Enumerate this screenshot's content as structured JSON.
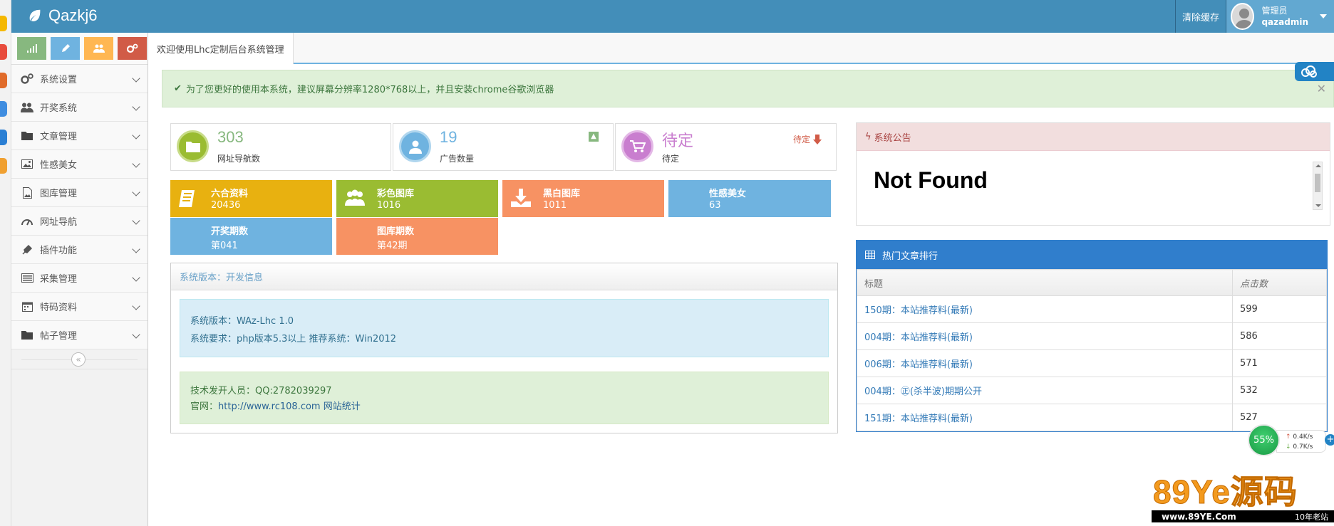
{
  "colors": {
    "navbar": "#438eb9",
    "green": "#87b87f",
    "blue": "#6fb3e0",
    "orange": "#ffb752",
    "red": "#d15b47",
    "tile_yellow": "#e8b110",
    "tile_green": "#9abc32",
    "tile_salmon": "#f79263",
    "tile_sky": "#6fb3e0",
    "hot_blue": "#307ecc"
  },
  "navbar": {
    "brand": "Qazkj6",
    "clear_cache": "清除缓存",
    "user_role": "管理员",
    "user_name": "qazadmin"
  },
  "shortcuts": [
    {
      "icon": "signal-icon"
    },
    {
      "icon": "pencil-icon"
    },
    {
      "icon": "users-icon"
    },
    {
      "icon": "cogs-icon"
    }
  ],
  "sidebar": {
    "items": [
      {
        "label": "系统设置",
        "icon": "cogs-icon"
      },
      {
        "label": "开奖系统",
        "icon": "users-icon"
      },
      {
        "label": "文章管理",
        "icon": "folder-icon"
      },
      {
        "label": "性感美女",
        "icon": "picture-icon"
      },
      {
        "label": "图库管理",
        "icon": "file-image-icon"
      },
      {
        "label": "网址导航",
        "icon": "dashboard-icon"
      },
      {
        "label": "插件功能",
        "icon": "plug-icon"
      },
      {
        "label": "采集管理",
        "icon": "list-alt-icon"
      },
      {
        "label": "特码资料",
        "icon": "calendar-icon"
      },
      {
        "label": "帖子管理",
        "icon": "folder-icon"
      }
    ]
  },
  "tab": {
    "label": "欢迎使用Lhc定制后台系统管理"
  },
  "alert": {
    "text": "为了您更好的使用本系统，建议屏幕分辨率1280*768以上，并且安装chrome谷歌浏览器"
  },
  "stats": [
    {
      "value": "303",
      "label": "网址导航数"
    },
    {
      "value": "19",
      "label": "广告数量"
    },
    {
      "value": "待定",
      "label": "待定",
      "badge": "待定"
    }
  ],
  "tiles": [
    {
      "title": "六合资料",
      "value": "20436"
    },
    {
      "title": "彩色图库",
      "value": "1016"
    },
    {
      "title": "黑白图库",
      "value": "1011"
    },
    {
      "title": "性感美女",
      "value": "63"
    },
    {
      "title": "开奖期数",
      "value": "第041"
    },
    {
      "title": "图库期数",
      "value": "第42期"
    }
  ],
  "info": {
    "header": "系统版本：开发信息",
    "version": "系统版本：WAz-Lhc 1.0",
    "requirements": "系统要求：php版本5.3以上  推荐系统：Win2012",
    "developer": "技术发开人员：QQ:2782039297",
    "site_label": "官网：",
    "site_url": "http://www.rc108.com",
    "site_stats": "网站统计"
  },
  "notice": {
    "header": "系统公告",
    "body": "Not Found"
  },
  "hot": {
    "header": "热门文章排行",
    "col_title": "标题",
    "col_clicks": "点击数",
    "rows": [
      {
        "title": "150期：本站推荐料(最新)",
        "clicks": "599"
      },
      {
        "title": "004期：本站推荐料(最新)",
        "clicks": "586"
      },
      {
        "title": "006期：本站推荐料(最新)",
        "clicks": "571"
      },
      {
        "title": "004期：㊣(杀半波)期期公开",
        "clicks": "532"
      },
      {
        "title": "151期：本站推荐料(最新)",
        "clicks": "527"
      }
    ]
  },
  "net_widget": {
    "percent": "55%",
    "up_rate": "0.4K/s",
    "down_rate": "0.7K/s"
  },
  "watermark": {
    "big": "89Ye源码",
    "site": "www.89YE.Com",
    "tag": "10年老站"
  }
}
